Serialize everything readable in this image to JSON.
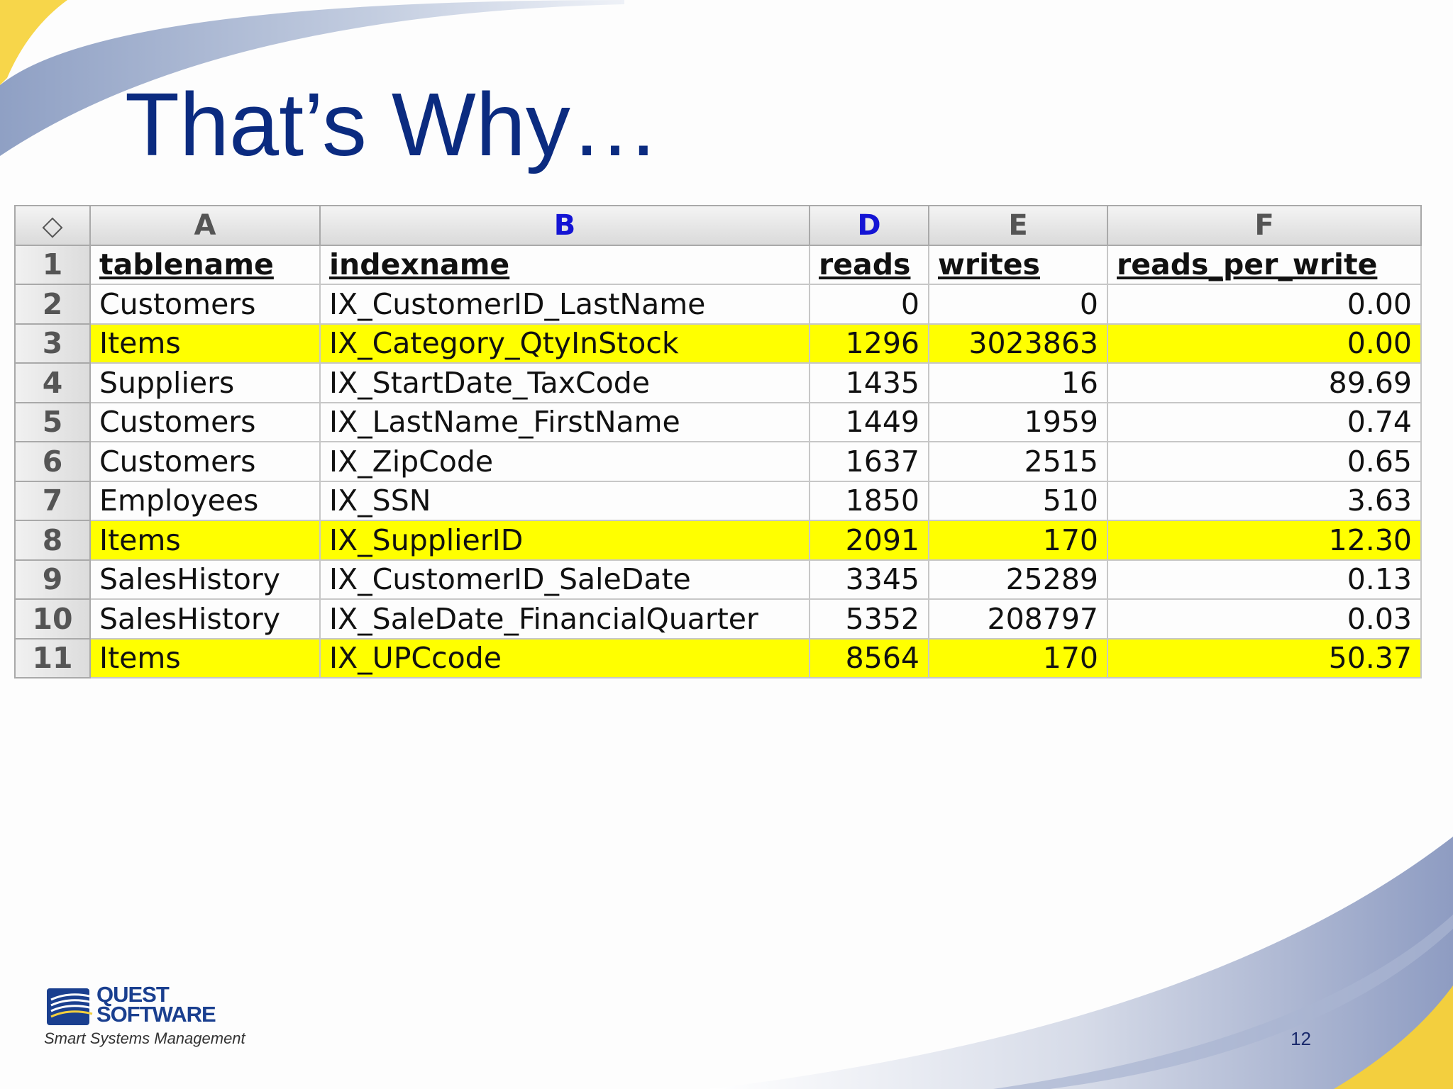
{
  "slide": {
    "title": "That’s Why…",
    "page_number": "12"
  },
  "logo": {
    "line1": "QUEST",
    "line2": "SOFTWARE",
    "tagline": "Smart Systems Management"
  },
  "spreadsheet": {
    "corner_symbol": "◇",
    "column_letters": [
      "A",
      "B",
      "D",
      "E",
      "F"
    ],
    "selected_columns": [
      "B",
      "D"
    ],
    "header_row_number": "1",
    "headers": [
      "tablename",
      "indexname",
      "reads",
      "writes",
      "reads_per_write"
    ],
    "rows": [
      {
        "num": "2",
        "cells": [
          "Customers",
          "IX_CustomerID_LastName",
          "0",
          "0",
          "0.00"
        ],
        "highlight": false
      },
      {
        "num": "3",
        "cells": [
          "Items",
          "IX_Category_QtyInStock",
          "1296",
          "3023863",
          "0.00"
        ],
        "highlight": true
      },
      {
        "num": "4",
        "cells": [
          "Suppliers",
          "IX_StartDate_TaxCode",
          "1435",
          "16",
          "89.69"
        ],
        "highlight": false
      },
      {
        "num": "5",
        "cells": [
          "Customers",
          "IX_LastName_FirstName",
          "1449",
          "1959",
          "0.74"
        ],
        "highlight": false
      },
      {
        "num": "6",
        "cells": [
          "Customers",
          "IX_ZipCode",
          "1637",
          "2515",
          "0.65"
        ],
        "highlight": false
      },
      {
        "num": "7",
        "cells": [
          "Employees",
          "IX_SSN",
          "1850",
          "510",
          "3.63"
        ],
        "highlight": false
      },
      {
        "num": "8",
        "cells": [
          "Items",
          "IX_SupplierID",
          "2091",
          "170",
          "12.30"
        ],
        "highlight": true
      },
      {
        "num": "9",
        "cells": [
          "SalesHistory",
          "IX_CustomerID_SaleDate",
          "3345",
          "25289",
          "0.13"
        ],
        "highlight": false
      },
      {
        "num": "10",
        "cells": [
          "SalesHistory",
          "IX_SaleDate_FinancialQuarter",
          "5352",
          "208797",
          "0.03"
        ],
        "highlight": false
      },
      {
        "num": "11",
        "cells": [
          "Items",
          "IX_UPCcode",
          "8564",
          "170",
          "50.37"
        ],
        "highlight": true
      }
    ]
  },
  "colors": {
    "title": "#0b2b80",
    "highlight": "#ffff00",
    "selected_column_letter": "#1414d4"
  }
}
